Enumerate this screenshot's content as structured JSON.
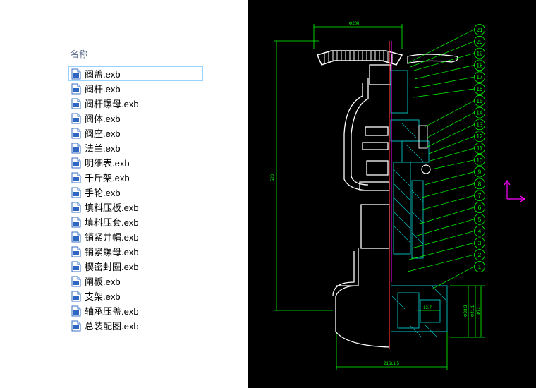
{
  "explorer": {
    "column_name": "名称",
    "files": [
      {
        "name": "阀盖.exb",
        "selected": true
      },
      {
        "name": "阀杆.exb"
      },
      {
        "name": "阀杆螺母.exb"
      },
      {
        "name": "阀体.exb"
      },
      {
        "name": "阀座.exb"
      },
      {
        "name": "法兰.exb"
      },
      {
        "name": "明细表.exb"
      },
      {
        "name": "千斤架.exb"
      },
      {
        "name": "手轮.exb"
      },
      {
        "name": "填料压板.exb"
      },
      {
        "name": "填料压套.exb"
      },
      {
        "name": "销紧井帽.exb"
      },
      {
        "name": "销紧螺母.exb"
      },
      {
        "name": "楔密封圈.exb"
      },
      {
        "name": "闸板.exb"
      },
      {
        "name": "支架.exb"
      },
      {
        "name": "轴承压盖.exb"
      },
      {
        "name": "总装配图.exb"
      }
    ],
    "file_icon": "document-icon"
  },
  "drawing": {
    "dim_top": "Φ200",
    "dim_left": "520",
    "dim_bottom": "216±1.5",
    "dim_inner": "12.7",
    "dim_r1": "Φ33.3",
    "dim_r2": "Φ41.1",
    "dim_r3": "Φ71",
    "balloons": [
      "21",
      "20",
      "19",
      "18",
      "17",
      "16",
      "15",
      "14",
      "13",
      "12",
      "11",
      "10",
      "9",
      "8",
      "7",
      "6",
      "5",
      "4",
      "3",
      "2",
      "1"
    ],
    "colors": {
      "background": "#000000",
      "outline": "#ffffff",
      "dimension": "#00ff00",
      "section": "#00c8c8",
      "centerline": "#ff3333",
      "accent": "#ff00ff",
      "balloon": "#00ff00"
    }
  }
}
